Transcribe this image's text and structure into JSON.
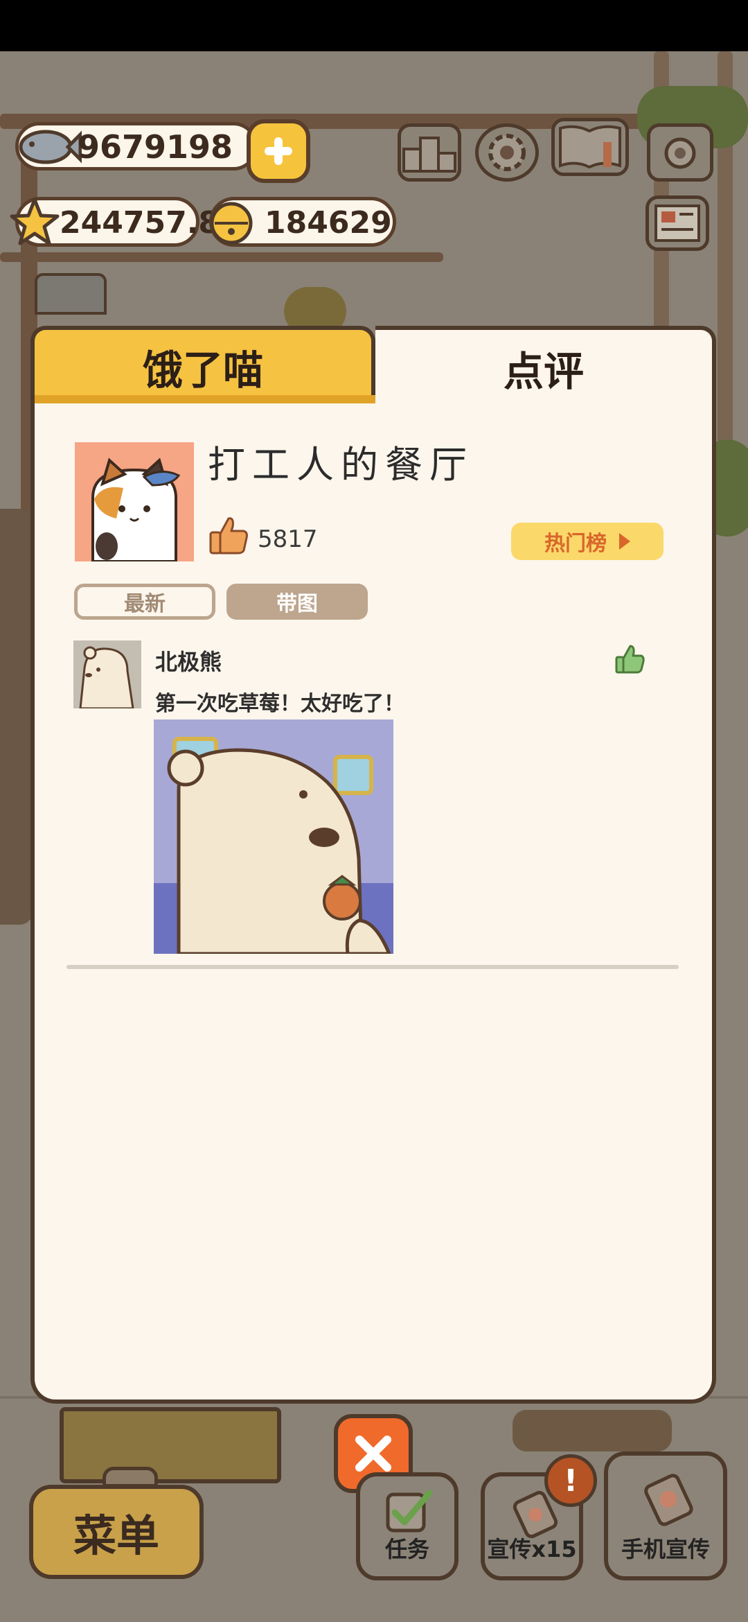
{
  "hud": {
    "fish": "9679198",
    "stars": "244757.8",
    "bells": "184629"
  },
  "dialog": {
    "tab_left": "饿了喵",
    "tab_right": "点评",
    "restaurant_name": "打工人的餐厅",
    "likes": "5817",
    "hot_list_label": "热门榜",
    "filters": {
      "newest": "最新",
      "with_image": "带图"
    },
    "review": {
      "user": "北极熊",
      "text": "第一次吃草莓！太好吃了！"
    }
  },
  "bottom": {
    "menu_label": "菜单",
    "tasks_label": "任务",
    "promo_label": "宣传x15",
    "phone_promo_label": "手机宣传",
    "badge": "!"
  },
  "colors": {
    "accent_yellow": "#f5c242",
    "panel_bg": "#fcf6ec",
    "border_brown": "#4e3a2b",
    "close_orange": "#f06a2b",
    "hot_text": "#d9662b"
  },
  "icons": [
    "fish-icon",
    "plus-icon",
    "star-icon",
    "bell-icon",
    "leaderboard-icon",
    "gear-icon",
    "book-icon",
    "camera-icon",
    "newspaper-icon",
    "thumbs-up-icon",
    "close-icon",
    "checkbox-icon",
    "promo-card-icon",
    "phone-promo-icon"
  ]
}
